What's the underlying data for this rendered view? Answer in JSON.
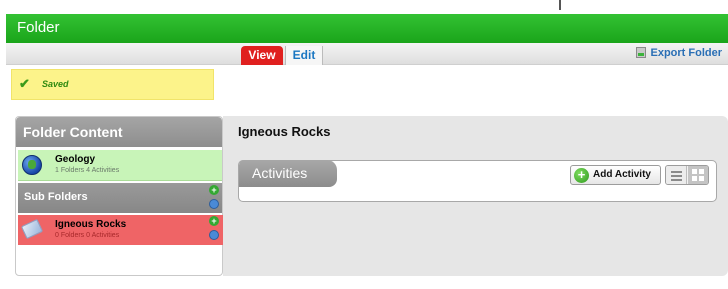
{
  "window": {
    "title": "Folder"
  },
  "tabs": [
    {
      "label": "View",
      "active": true
    },
    {
      "label": "Edit",
      "active": false
    }
  ],
  "toolbar": {
    "export_label": "Export Folder"
  },
  "status": {
    "text": "Saved",
    "color": "#2f8a10"
  },
  "sidebar": {
    "header": "Folder Content",
    "root": {
      "title": "Geology",
      "subtitle": "1 Folders 4 Activities",
      "icon": "globe-icon"
    },
    "section_label": "Sub Folders",
    "selected": {
      "title": "Igneous Rocks",
      "subtitle": "0 Folders 0 Activities",
      "icon": "rock-icon"
    }
  },
  "main": {
    "title": "Igneous Rocks",
    "activities_label": "Activities",
    "add_activity_label": "Add Activity"
  },
  "colors": {
    "title_bar": "#1aa51a",
    "active_tab": "#e0201f",
    "selected_item": "#ef6466",
    "root_item": "#c8f4b8",
    "saved_bar": "#fcf38a"
  }
}
